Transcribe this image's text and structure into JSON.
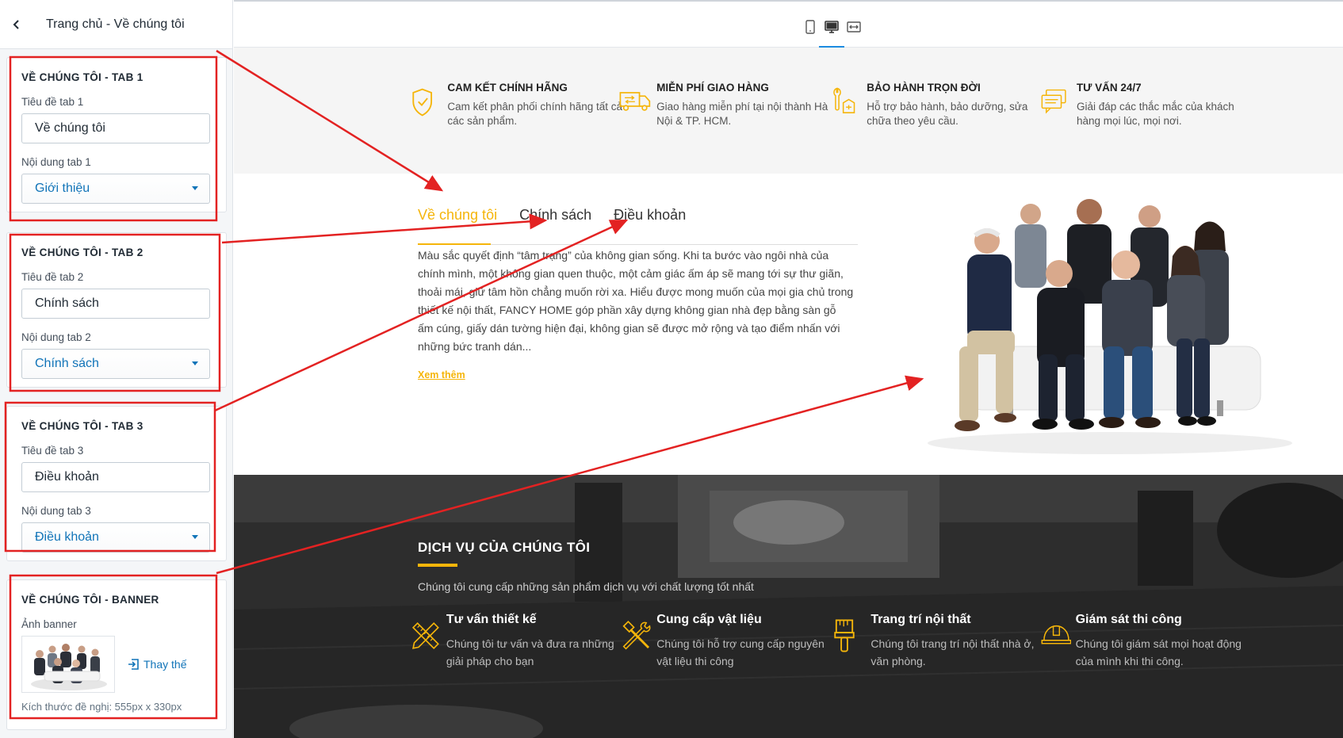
{
  "sidebar": {
    "title": "Trang chủ - Về chúng tôi",
    "sections": [
      {
        "heading": "VỀ CHÚNG TÔI - TAB 1",
        "title_label": "Tiêu đề tab 1",
        "title_value": "Về chúng tôi",
        "content_label": "Nội dung tab 1",
        "content_value": "Giới thiệu"
      },
      {
        "heading": "VỀ CHÚNG TÔI - TAB 2",
        "title_label": "Tiêu đề tab 2",
        "title_value": "Chính sách",
        "content_label": "Nội dung tab 2",
        "content_value": "Chính sách"
      },
      {
        "heading": "VỀ CHÚNG TÔI - TAB 3",
        "title_label": "Tiêu đề tab 3",
        "title_value": "Điều khoản",
        "content_label": "Nội dung tab 3",
        "content_value": "Điều khoản"
      }
    ],
    "banner": {
      "heading": "VỀ CHÚNG TÔI - BANNER",
      "label": "Ảnh banner",
      "replace": "Thay thế",
      "hint": "Kích thước đề nghị: 555px x 330px"
    }
  },
  "preview": {
    "features": [
      {
        "icon": "shield-check-icon",
        "title": "CAM KẾT CHÍNH HÃNG",
        "desc": "Cam kết phân phối chính hãng tất cả các sản phẩm."
      },
      {
        "icon": "truck-icon",
        "title": "MIỄN PHÍ GIAO HÀNG",
        "desc": "Giao hàng miễn phí tại nội thành Hà Nội & TP. HCM."
      },
      {
        "icon": "wrench-icon",
        "title": "BẢO HÀNH TRỌN ĐỜI",
        "desc": "Hỗ trợ bảo hành, bảo dưỡng, sửa chữa theo yêu cầu."
      },
      {
        "icon": "chat-icon",
        "title": "TƯ VẤN 24/7",
        "desc": "Giải đáp các thắc mắc của khách hàng mọi lúc, mọi nơi."
      }
    ],
    "tabs": [
      "Về chúng tôi",
      "Chính sách",
      "Điều khoản"
    ],
    "about_text": "Màu sắc quyết định “tâm trạng” của không gian sống. Khi ta bước vào ngôi nhà của chính mình, một không gian quen thuộc, một cảm giác ấm áp sẽ mang tới sự thư giãn, thoải mái, giữ tâm hồn chẳng muốn rời xa. Hiểu được mong muốn của mọi gia chủ trong thiết kế nội thất, FANCY HOME góp phần xây dựng không gian nhà đẹp bằng sàn gỗ ấm cúng, giấy dán tường hiện đại, không gian sẽ được mở rộng và tạo điểm nhấn với những bức tranh dán...",
    "read_more": "Xem thêm",
    "services": {
      "title": "DỊCH VỤ CỦA CHÚNG TÔI",
      "subtitle": "Chúng tôi cung cấp những sản phẩm dịch vụ với chất lượng tốt nhất",
      "items": [
        {
          "icon": "ruler-pencil-icon",
          "title": "Tư vấn thiết kế",
          "desc": "Chúng tôi tư vấn và đưa ra những giải pháp cho bạn"
        },
        {
          "icon": "hammer-wrench-icon",
          "title": "Cung cấp vật liệu",
          "desc": "Chúng tôi hỗ trợ cung cấp nguyên vật liệu thi công"
        },
        {
          "icon": "paint-brush-icon",
          "title": "Trang trí nội thất",
          "desc": "Chúng tôi trang trí nội thất nhà ở, văn phòng."
        },
        {
          "icon": "helmet-icon",
          "title": "Giám sát thi công",
          "desc": "Chúng tôi giám sát mọi hoạt động của mình khi thi công."
        }
      ]
    }
  },
  "colors": {
    "accent": "#f5b50a",
    "link": "#1174b8",
    "annotation": "#e32222"
  }
}
